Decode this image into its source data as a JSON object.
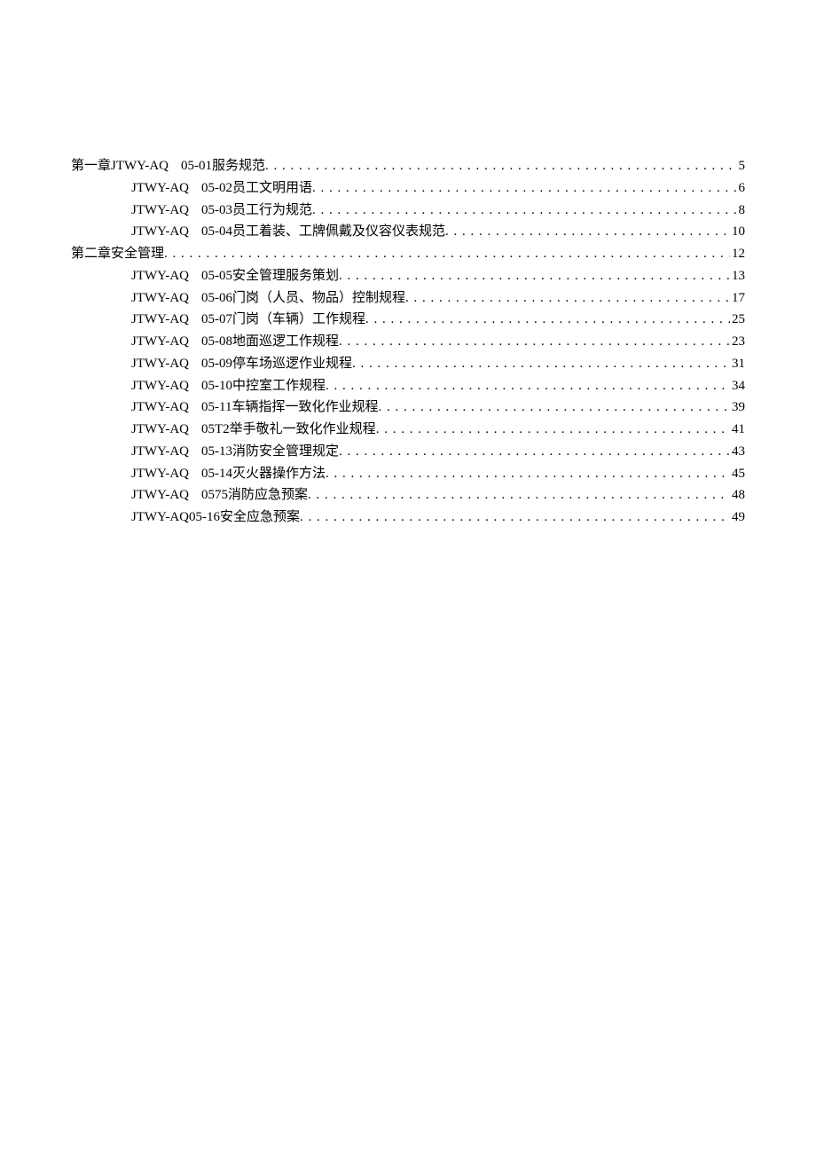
{
  "toc": [
    {
      "prefix": "第一章 ",
      "code": "JTWY-AQ",
      "sep": "gap",
      "num": "05-01 ",
      "title": "服务规范",
      "page": "5",
      "indent": false
    },
    {
      "prefix": "",
      "code": "JTWY-AQ",
      "sep": "gap",
      "num": "05-02 ",
      "title": "员工文明用语 ",
      "page": "6",
      "indent": true
    },
    {
      "prefix": "",
      "code": "JTWY-AQ",
      "sep": "gap",
      "num": "05-03 ",
      "title": "员工行为规范",
      "page": "8",
      "indent": true
    },
    {
      "prefix": "",
      "code": "JTWY-AQ",
      "sep": "gap",
      "num": "05-04 ",
      "title": "员工着装、工牌佩戴及仪容仪表规范",
      "page": "10",
      "indent": true
    },
    {
      "prefix": "第二章安全管理",
      "code": "",
      "sep": "",
      "num": "",
      "title": "",
      "page": "12",
      "indent": false
    },
    {
      "prefix": "",
      "code": "JTWY-AQ",
      "sep": "gap",
      "num": "05-05 ",
      "title": "安全管理服务策划",
      "page": "13",
      "indent": true
    },
    {
      "prefix": "",
      "code": "JTWY-AQ",
      "sep": "gap",
      "num": "05-06 ",
      "title": "门岗（人员、物品）控制规程",
      "page": "17",
      "indent": true
    },
    {
      "prefix": "",
      "code": "JTWY-AQ",
      "sep": "gap",
      "num": "05-07 ",
      "title": "门岗（车辆）工作规程",
      "page": "25",
      "indent": true
    },
    {
      "prefix": "",
      "code": "JTWY-AQ",
      "sep": "gap",
      "num": "05-08 ",
      "title": "地面巡逻工作规程",
      "page": "23",
      "indent": true
    },
    {
      "prefix": "",
      "code": "JTWY-AQ",
      "sep": "gap",
      "num": "05-09 ",
      "title": "停车场巡逻作业规程",
      "page": "31",
      "indent": true
    },
    {
      "prefix": "",
      "code": "JTWY-AQ",
      "sep": "gap",
      "num": "05-10 ",
      "title": "中控室工作规程",
      "page": "34",
      "indent": true
    },
    {
      "prefix": "",
      "code": "JTWY-AQ",
      "sep": "gap",
      "num": "05-11 ",
      "title": "车辆指挥一致化作业规程",
      "page": "39",
      "indent": true
    },
    {
      "prefix": "",
      "code": "JTWY-AQ",
      "sep": "gap",
      "num": "05T2 ",
      "title": "举手敬礼一致化作业规程 ",
      "page": "41",
      "indent": true
    },
    {
      "prefix": "",
      "code": "JTWY-AQ",
      "sep": "gap",
      "num": "05-13 ",
      "title": "消防安全管理规定",
      "page": "43",
      "indent": true
    },
    {
      "prefix": "",
      "code": "JTWY-AQ",
      "sep": "gap",
      "num": "05-14 ",
      "title": "灭火器操作方法",
      "page": "45",
      "indent": true
    },
    {
      "prefix": "",
      "code": "JTWY-AQ",
      "sep": "gap",
      "num": "0575 ",
      "title": "消防应急预案 ",
      "page": "48",
      "indent": true
    },
    {
      "prefix": "",
      "code": "JTWY-AQ",
      "sep": "none",
      "num": "05-16 ",
      "title": "安全应急预案 ",
      "page": "49",
      "indent": true
    }
  ]
}
